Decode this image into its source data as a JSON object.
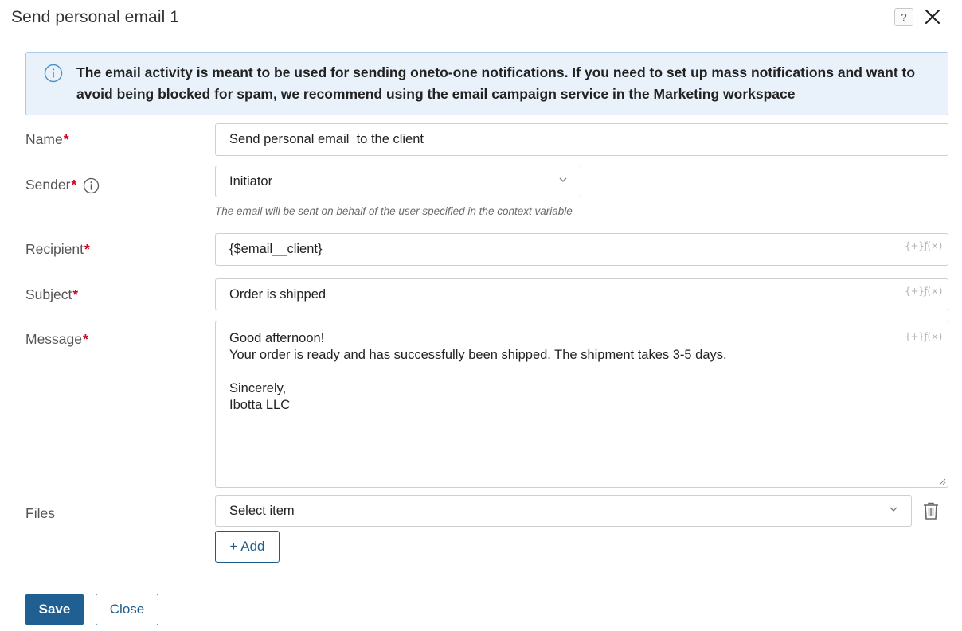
{
  "dialog": {
    "title": "Send personal email 1",
    "help_label": "?"
  },
  "info": {
    "text": "The email activity is meant to be used for sending oneto-one notifications. If you need to set up mass notifications and want to avoid being blocked for spam, we recommend using the email campaign service in the Marketing workspace"
  },
  "form": {
    "required_mark": "*",
    "fx_label": "{+}ƒ(×)",
    "name": {
      "label": "Name",
      "value": "Send personal email  to the client"
    },
    "sender": {
      "label": "Sender",
      "value": "Initiator",
      "hint": "The email will be sent on behalf of the user specified in the context variable"
    },
    "recipient": {
      "label": "Recipient",
      "value": "{$email__client}"
    },
    "subject": {
      "label": "Subject",
      "value": "Order is shipped"
    },
    "message": {
      "label": "Message",
      "value": "Good afternoon!\nYour order is ready and has successfully been shipped. The shipment takes 3-5 days.\n\nSincerely,\nIbotta LLC"
    },
    "files": {
      "label": "Files",
      "value": "Select item",
      "add_label": "+ Add"
    }
  },
  "footer": {
    "save_label": "Save",
    "close_label": "Close"
  },
  "colors": {
    "primary": "#1f5f92",
    "required": "#d0021b",
    "banner_bg": "#e9f2fa",
    "banner_border": "#a9c9e6"
  },
  "icons": [
    "help-icon",
    "close-icon",
    "info-icon",
    "chevron-down-icon",
    "trash-icon",
    "resize-handle-icon"
  ]
}
